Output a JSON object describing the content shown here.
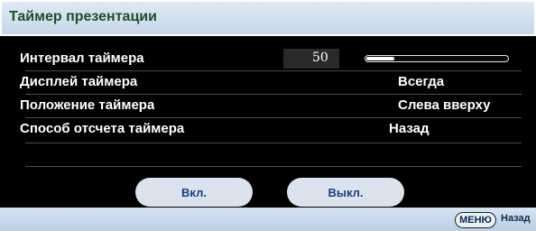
{
  "title": "Таймер презентации",
  "rows": [
    {
      "label": "Интервал таймера",
      "number": "50",
      "progress": 0.2
    },
    {
      "label": "Дисплей таймера",
      "value": "Всегда"
    },
    {
      "label": "Положение таймера",
      "value": "Слева вверху"
    },
    {
      "label": "Способ отсчета таймера",
      "value": "Назад"
    }
  ],
  "buttons": {
    "on_label": "Вкл.",
    "off_label": "Выкл."
  },
  "status": {
    "menu_key": "МЕНЮ",
    "back_label": "Назад"
  },
  "colors": {
    "title_text": "#1f4d2a",
    "button_bg": "#dbe3ee",
    "button_text": "#1b3f7a",
    "status_bg": "#d5e3f2"
  }
}
